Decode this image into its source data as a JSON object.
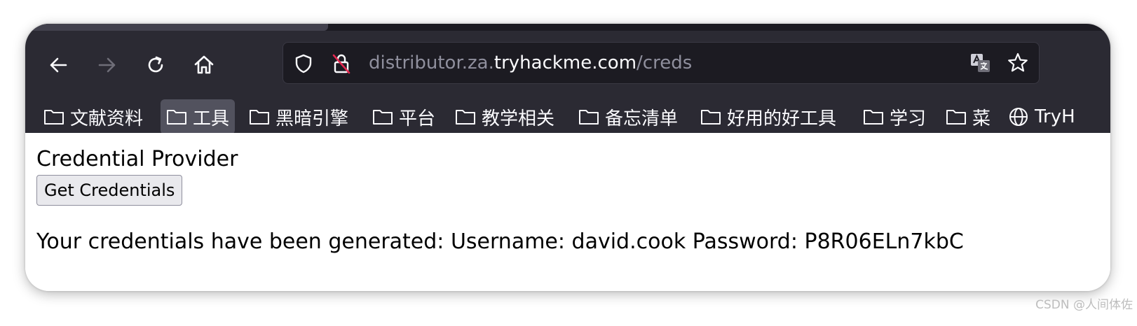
{
  "browser": {
    "url": {
      "prefix": "distributor.za.",
      "host": "tryhackme.com",
      "path": "/creds"
    },
    "nav_icons": [
      "back-arrow-icon",
      "forward-arrow-icon",
      "reload-icon",
      "home-icon"
    ],
    "bookmarks": [
      {
        "label": "文献资料",
        "icon": "folder-icon"
      },
      {
        "label": "工具",
        "icon": "folder-icon",
        "hovered": true
      },
      {
        "label": "黑暗引擎",
        "icon": "folder-icon"
      },
      {
        "label": "平台",
        "icon": "folder-icon"
      },
      {
        "label": "教学相关",
        "icon": "folder-icon"
      },
      {
        "label": "备忘清单",
        "icon": "folder-icon"
      },
      {
        "label": "好用的好工具",
        "icon": "folder-icon"
      },
      {
        "label": "学习",
        "icon": "folder-icon"
      },
      {
        "label": "菜",
        "icon": "folder-icon"
      },
      {
        "label": "TryH",
        "icon": "globe-icon"
      }
    ]
  },
  "page": {
    "heading": "Credential Provider",
    "button_label": "Get Credentials",
    "result_text": "Your credentials have been generated: Username: david.cook Password: P8R06ELn7kbC"
  },
  "watermark": "CSDN @人间体佐",
  "colors": {
    "toolbar_bg": "#2b2a33",
    "urlbar_bg": "#1c1b22",
    "toolbar_text": "#fbfbfe",
    "url_dim": "#8f8f9d",
    "page_bg": "#ffffff"
  }
}
